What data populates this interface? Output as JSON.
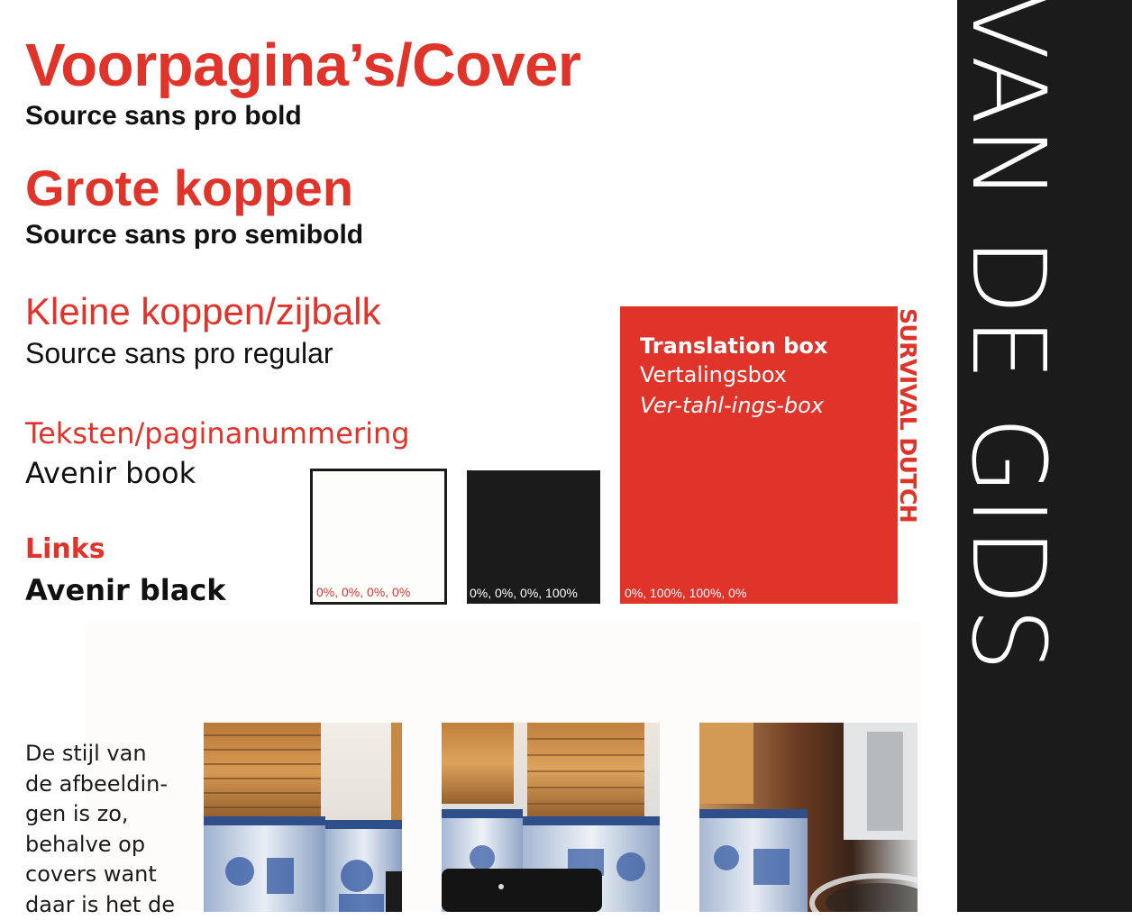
{
  "typography": {
    "cover_heading": "Voorpagina’s/Cover",
    "cover_font": "Source sans pro bold",
    "big_heading": "Grote koppen",
    "big_font": "Source sans pro semibold",
    "small_heading": "Kleine koppen/zijbalk",
    "small_font": "Source sans pro regular",
    "text_heading": "Teksten/paginanummering",
    "text_font": "Avenir book",
    "links_heading": "Links",
    "links_font": "Avenir black"
  },
  "swatches": [
    {
      "label": "0%, 0%, 0%, 0%",
      "color": "#fdfdfb"
    },
    {
      "label": "0%, 0%, 0%, 100%",
      "color": "#1c1b1b"
    },
    {
      "label": "0%, 100%, 100%, 0%",
      "color": "#e0332a"
    }
  ],
  "translation_box": {
    "title": "Translation box",
    "dutch": "Vertalingsbox",
    "pronunciation": "Ver-tahl-ings-box"
  },
  "side_label": "SURVIVAL DUTCH",
  "side_title": "VAN DE GIDS",
  "body_text": {
    "lines": [
      "De stijl van",
      "de afbeeldin-",
      "gen is zo,",
      "behalve op",
      "covers want",
      "daar is het de"
    ]
  },
  "colors": {
    "accent_red": "#e0332a",
    "black": "#1c1b1b",
    "white": "#fdfdfb"
  }
}
